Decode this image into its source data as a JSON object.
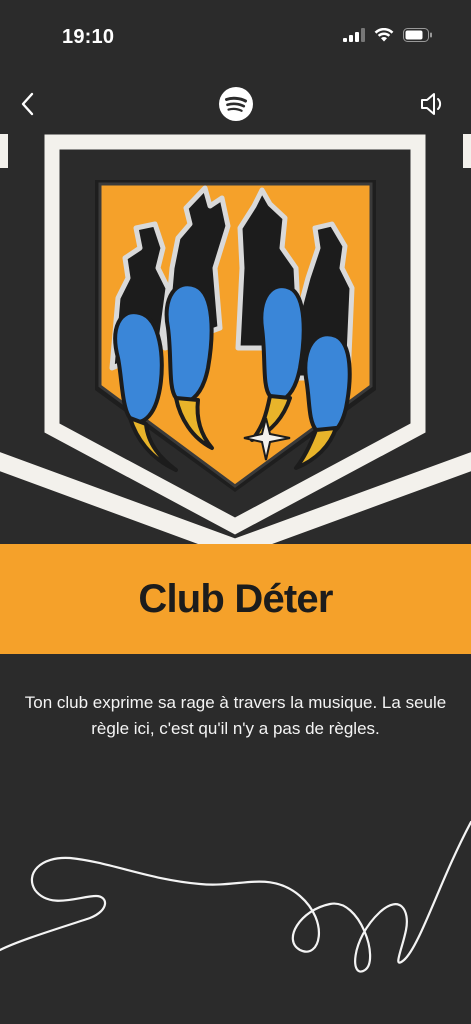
{
  "status_bar": {
    "time": "19:10",
    "icons": [
      "cellular-signal-icon",
      "wifi-icon",
      "battery-icon"
    ]
  },
  "nav": {
    "back_icon": "chevron-left-icon",
    "logo": "spotify-logo-icon",
    "sound_icon": "speaker-icon"
  },
  "artwork": {
    "description_icon": "claw-badge-pin",
    "colors": {
      "badge": "#f5a12a",
      "claw": "#3a86d8",
      "nail": "#e8b42a",
      "frame": "#f3f1ec",
      "background": "#2b2b2b"
    }
  },
  "club": {
    "title": "Club Déter",
    "description": "Ton club exprime sa rage à travers la musique. La seule règle ici, c'est qu'il n'y a pas de règles."
  },
  "theme": {
    "accent": "#f5a12a",
    "background": "#2b2b2b",
    "text": "#ffffff"
  }
}
